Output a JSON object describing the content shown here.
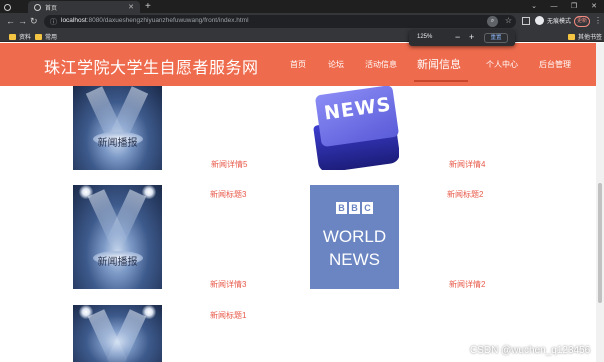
{
  "browser": {
    "tabs": [
      {
        "label": "",
        "active": false
      },
      {
        "label": "首页",
        "active": true
      }
    ],
    "url_host": "localhost",
    "url_path": ":8080/daxueshengzhiyuanzhefuwuwang/front/index.html",
    "profile_label": "无痕模式",
    "update_label": "更新",
    "zoom": {
      "percent": "125%",
      "reset_label": "重置"
    },
    "bookmarks": [
      {
        "label": "资料"
      },
      {
        "label": "常用"
      }
    ],
    "other_bookmarks_label": "其他书签"
  },
  "site": {
    "title": "珠江学院大学生自愿者服务网",
    "nav": [
      {
        "label": "首页",
        "active": false
      },
      {
        "label": "论坛",
        "active": false
      },
      {
        "label": "活动信息",
        "active": false
      },
      {
        "label": "新闻信息",
        "active": true
      },
      {
        "label": "个人中心",
        "active": false
      },
      {
        "label": "后台管理",
        "active": false
      }
    ],
    "accent_color": "#ef6b4d",
    "link_color": "#e85a4a"
  },
  "news": {
    "thumb_caption": "新闻播报",
    "key_text": "NEWS",
    "bbc_letters": [
      "B",
      "B",
      "C"
    ],
    "bbc_world": "WORLD",
    "bbc_news": "NEWS",
    "items": [
      {
        "detail": "新闻详情5",
        "title": ""
      },
      {
        "detail": "新闻详情4",
        "title": ""
      },
      {
        "detail": "新闻详情3",
        "title": "新闻标题3"
      },
      {
        "detail": "新闻详情2",
        "title": "新闻标题2"
      },
      {
        "detail": "",
        "title": "新闻标题1"
      }
    ]
  },
  "watermark": "CSDN @wuchen_q123456"
}
